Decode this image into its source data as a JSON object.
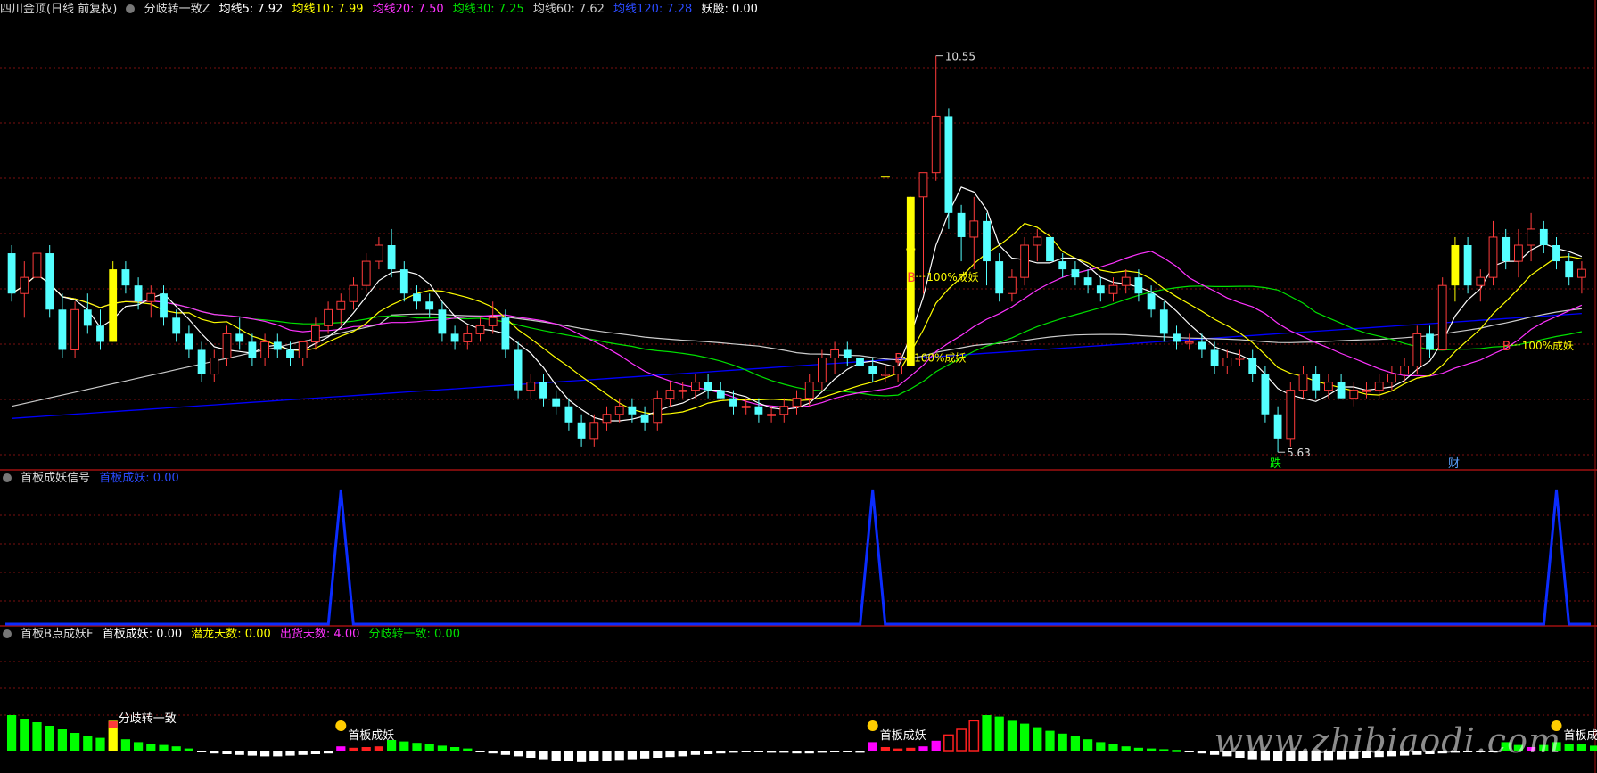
{
  "colors": {
    "up": "#ff3b3b",
    "down": "#54ffff",
    "ma5": "#ffffff",
    "ma10": "#ffff00",
    "ma20": "#ff33ff",
    "ma30": "#00e000",
    "ma60": "#cccccc",
    "ma120": "#0000ff",
    "grid": "#7a1010",
    "signal": "#ff33ff",
    "blue_line": "#0b2cff",
    "green_bar": "#00ff00",
    "white_bar": "#ffffff",
    "magenta_bar": "#ff00ff",
    "red_bar": "#ff2020",
    "yellow": "#ffff00"
  },
  "panel1": {
    "title": "四川金顶(日线 前复权)",
    "indicator": "分歧转一致Z",
    "ma5": "均线5: 7.92",
    "ma10": "均线10: 7.99",
    "ma20": "均线20: 7.50",
    "ma30": "均线30: 7.25",
    "ma60": "均线60: 7.62",
    "ma120": "均线120: 7.28",
    "yaogu": "妖股: 0.00",
    "high_label": "10.55",
    "low_label": "5.63",
    "annotations": [
      "100%成妖",
      "100%成妖",
      "100%成妖"
    ],
    "b_labels": [
      "B",
      "B",
      "B"
    ],
    "die_label": "跌",
    "cai_label": "财"
  },
  "panel2": {
    "title": "首板成妖信号",
    "value_label": "首板成妖: 0.00"
  },
  "panel3": {
    "title": "首板B点成妖F",
    "v1": "首板成妖: 0.00",
    "v2": "潜龙天数: 0.00",
    "v3": "出货天数: 4.00",
    "v4": "分歧转一致: 0.00",
    "labels": [
      "分歧转一致",
      "首板成妖",
      "首板成妖",
      "首板成妖"
    ]
  },
  "watermark": "www.zhibiaodi.com",
  "chart_data": [
    {
      "type": "candlestick",
      "title": "四川金顶(日线 前复权)",
      "high": 10.55,
      "low": 5.63,
      "ylim": [
        5.4,
        11.0
      ],
      "ohlc": [
        [
          8.1,
          8.2,
          7.5,
          7.6
        ],
        [
          7.6,
          8.0,
          7.3,
          7.8
        ],
        [
          7.8,
          8.3,
          7.7,
          8.1
        ],
        [
          8.1,
          8.2,
          7.3,
          7.4
        ],
        [
          7.4,
          7.6,
          6.8,
          6.9
        ],
        [
          6.9,
          7.5,
          6.8,
          7.4
        ],
        [
          7.4,
          7.6,
          7.1,
          7.2
        ],
        [
          7.2,
          7.4,
          6.9,
          7.0
        ],
        [
          7.0,
          8.0,
          7.0,
          7.9
        ],
        [
          7.9,
          8.0,
          7.6,
          7.7
        ],
        [
          7.7,
          7.8,
          7.4,
          7.5
        ],
        [
          7.5,
          7.7,
          7.3,
          7.6
        ],
        [
          7.6,
          7.7,
          7.2,
          7.3
        ],
        [
          7.3,
          7.4,
          7.0,
          7.1
        ],
        [
          7.1,
          7.2,
          6.8,
          6.9
        ],
        [
          6.9,
          7.0,
          6.5,
          6.6
        ],
        [
          6.6,
          6.9,
          6.5,
          6.8
        ],
        [
          6.8,
          7.2,
          6.7,
          7.1
        ],
        [
          7.1,
          7.3,
          6.9,
          7.0
        ],
        [
          7.0,
          7.1,
          6.7,
          6.8
        ],
        [
          6.8,
          7.1,
          6.7,
          7.0
        ],
        [
          7.0,
          7.1,
          6.8,
          6.9
        ],
        [
          6.9,
          7.0,
          6.7,
          6.8
        ],
        [
          6.8,
          7.0,
          6.7,
          7.0
        ],
        [
          7.0,
          7.3,
          6.9,
          7.2
        ],
        [
          7.2,
          7.5,
          7.1,
          7.4
        ],
        [
          7.4,
          7.6,
          7.2,
          7.5
        ],
        [
          7.5,
          7.8,
          7.4,
          7.7
        ],
        [
          7.7,
          8.1,
          7.6,
          8.0
        ],
        [
          8.0,
          8.3,
          7.9,
          8.2
        ],
        [
          8.2,
          8.4,
          7.8,
          7.9
        ],
        [
          7.9,
          8.0,
          7.5,
          7.6
        ],
        [
          7.6,
          7.7,
          7.4,
          7.5
        ],
        [
          7.5,
          7.6,
          7.3,
          7.4
        ],
        [
          7.4,
          7.5,
          7.0,
          7.1
        ],
        [
          7.1,
          7.2,
          6.9,
          7.0
        ],
        [
          7.0,
          7.2,
          6.9,
          7.1
        ],
        [
          7.1,
          7.3,
          7.0,
          7.2
        ],
        [
          7.2,
          7.5,
          7.1,
          7.3
        ],
        [
          7.3,
          7.4,
          6.8,
          6.9
        ],
        [
          6.9,
          7.0,
          6.3,
          6.4
        ],
        [
          6.4,
          6.6,
          6.3,
          6.5
        ],
        [
          6.5,
          6.6,
          6.2,
          6.3
        ],
        [
          6.3,
          6.4,
          6.1,
          6.2
        ],
        [
          6.2,
          6.3,
          5.9,
          6.0
        ],
        [
          6.0,
          6.1,
          5.7,
          5.8
        ],
        [
          5.8,
          6.1,
          5.7,
          6.0
        ],
        [
          6.0,
          6.2,
          5.9,
          6.1
        ],
        [
          6.1,
          6.3,
          6.0,
          6.2
        ],
        [
          6.2,
          6.3,
          6.0,
          6.1
        ],
        [
          6.1,
          6.2,
          5.9,
          6.0
        ],
        [
          6.0,
          6.4,
          5.9,
          6.3
        ],
        [
          6.3,
          6.5,
          6.2,
          6.4
        ],
        [
          6.4,
          6.5,
          6.3,
          6.4
        ],
        [
          6.4,
          6.6,
          6.3,
          6.5
        ],
        [
          6.5,
          6.6,
          6.3,
          6.4
        ],
        [
          6.4,
          6.5,
          6.3,
          6.3
        ],
        [
          6.3,
          6.4,
          6.1,
          6.2
        ],
        [
          6.2,
          6.3,
          6.1,
          6.2
        ],
        [
          6.2,
          6.3,
          6.0,
          6.1
        ],
        [
          6.1,
          6.2,
          6.0,
          6.1
        ],
        [
          6.1,
          6.3,
          6.0,
          6.2
        ],
        [
          6.2,
          6.4,
          6.1,
          6.3
        ],
        [
          6.3,
          6.6,
          6.2,
          6.5
        ],
        [
          6.5,
          6.9,
          6.4,
          6.8
        ],
        [
          6.8,
          7.0,
          6.6,
          6.9
        ],
        [
          6.9,
          7.0,
          6.7,
          6.8
        ],
        [
          6.8,
          6.9,
          6.6,
          6.7
        ],
        [
          6.7,
          6.8,
          6.5,
          6.6
        ],
        [
          6.6,
          6.7,
          6.5,
          6.6
        ],
        [
          6.6,
          6.8,
          6.5,
          6.7
        ],
        [
          6.7,
          8.8,
          6.7,
          8.8
        ],
        [
          8.8,
          9.1,
          7.6,
          9.1
        ],
        [
          9.1,
          10.55,
          9.0,
          9.8
        ],
        [
          9.8,
          9.9,
          8.4,
          8.6
        ],
        [
          8.6,
          8.7,
          8.0,
          8.3
        ],
        [
          8.3,
          8.8,
          7.9,
          8.5
        ],
        [
          8.5,
          8.6,
          7.7,
          8.0
        ],
        [
          8.0,
          8.1,
          7.5,
          7.6
        ],
        [
          7.6,
          7.9,
          7.5,
          7.8
        ],
        [
          7.8,
          8.3,
          7.7,
          8.2
        ],
        [
          8.2,
          8.4,
          8.0,
          8.3
        ],
        [
          8.3,
          8.4,
          7.9,
          8.0
        ],
        [
          8.0,
          8.1,
          7.8,
          7.9
        ],
        [
          7.9,
          8.0,
          7.7,
          7.8
        ],
        [
          7.8,
          7.9,
          7.6,
          7.7
        ],
        [
          7.7,
          7.8,
          7.5,
          7.6
        ],
        [
          7.6,
          7.8,
          7.5,
          7.7
        ],
        [
          7.7,
          7.9,
          7.6,
          7.8
        ],
        [
          7.8,
          7.9,
          7.5,
          7.6
        ],
        [
          7.6,
          7.7,
          7.3,
          7.4
        ],
        [
          7.4,
          7.5,
          7.0,
          7.1
        ],
        [
          7.1,
          7.2,
          6.9,
          7.0
        ],
        [
          7.0,
          7.1,
          6.9,
          7.0
        ],
        [
          7.0,
          7.1,
          6.8,
          6.9
        ],
        [
          6.9,
          7.0,
          6.6,
          6.7
        ],
        [
          6.7,
          6.9,
          6.6,
          6.8
        ],
        [
          6.8,
          6.9,
          6.7,
          6.8
        ],
        [
          6.8,
          6.9,
          6.5,
          6.6
        ],
        [
          6.6,
          6.7,
          6.0,
          6.1
        ],
        [
          6.1,
          6.2,
          5.63,
          5.8
        ],
        [
          5.8,
          6.5,
          5.7,
          6.4
        ],
        [
          6.4,
          6.7,
          6.3,
          6.6
        ],
        [
          6.6,
          6.7,
          6.3,
          6.4
        ],
        [
          6.4,
          6.6,
          6.3,
          6.5
        ],
        [
          6.5,
          6.6,
          6.3,
          6.3
        ],
        [
          6.3,
          6.5,
          6.2,
          6.4
        ],
        [
          6.4,
          6.5,
          6.3,
          6.4
        ],
        [
          6.4,
          6.6,
          6.3,
          6.5
        ],
        [
          6.5,
          6.7,
          6.4,
          6.6
        ],
        [
          6.6,
          6.8,
          6.5,
          6.7
        ],
        [
          6.7,
          7.2,
          6.6,
          7.1
        ],
        [
          7.1,
          7.2,
          6.8,
          6.9
        ],
        [
          6.9,
          7.8,
          6.9,
          7.7
        ],
        [
          7.7,
          8.3,
          7.5,
          8.2
        ],
        [
          8.2,
          8.3,
          7.6,
          7.7
        ],
        [
          7.7,
          7.9,
          7.5,
          7.8
        ],
        [
          7.8,
          8.5,
          7.7,
          8.3
        ],
        [
          8.3,
          8.4,
          7.9,
          8.0
        ],
        [
          8.0,
          8.4,
          7.8,
          8.2
        ],
        [
          8.2,
          8.6,
          8.0,
          8.4
        ],
        [
          8.4,
          8.5,
          8.1,
          8.2
        ],
        [
          8.2,
          8.3,
          7.9,
          8.0
        ],
        [
          8.0,
          8.1,
          7.7,
          7.8
        ],
        [
          7.8,
          8.0,
          7.6,
          7.9
        ]
      ],
      "limit_up_days": [
        8,
        71,
        114
      ]
    },
    {
      "type": "line",
      "title": "首板成妖信号",
      "signal_indices": [
        26,
        68,
        122
      ],
      "values_note_range": [
        0,
        1
      ]
    },
    {
      "type": "bar",
      "title": "首板B点成妖F",
      "values": [
        5,
        4.5,
        4,
        3.5,
        3,
        2.5,
        2,
        1.8,
        4.2,
        1.6,
        1.2,
        1,
        0.8,
        0.6,
        0.3,
        -0.2,
        -0.4,
        -0.5,
        -0.6,
        -0.7,
        -0.8,
        -0.8,
        -0.7,
        -0.6,
        -0.5,
        -0.4,
        0.6,
        0.4,
        0.5,
        0.6,
        1.5,
        1.3,
        1.1,
        0.9,
        0.7,
        0.5,
        0.3,
        -0.2,
        -0.4,
        -0.6,
        -0.8,
        -1.0,
        -1.2,
        -1.4,
        -1.5,
        -1.6,
        -1.5,
        -1.4,
        -1.3,
        -1.2,
        -1.1,
        -1.0,
        -0.9,
        -0.8,
        -0.6,
        -0.5,
        -0.4,
        -0.3,
        -0.2,
        -0.2,
        -0.3,
        -0.3,
        -0.4,
        -0.4,
        -0.3,
        -0.2,
        -0.1,
        -0.3,
        1.2,
        0.5,
        0.3,
        0.4,
        0.6,
        1.4,
        2.2,
        3.0,
        4.2,
        5.0,
        4.8,
        4.2,
        3.8,
        3.3,
        2.8,
        2.4,
        2.0,
        1.6,
        1.2,
        0.9,
        0.6,
        0.4,
        0.3,
        0.2,
        0.1,
        -0.2,
        -0.4,
        -0.6,
        -0.8,
        -1.0,
        -1.2,
        -1.3,
        -1.4,
        -1.5,
        -1.5,
        -1.4,
        -1.3,
        -1.2,
        -1.1,
        -1.0,
        -0.9,
        -0.8,
        -0.7,
        -0.6,
        -0.5,
        -0.4,
        -0.3,
        -0.2,
        -0.1,
        -0.2,
        1.2,
        0.8,
        0.5,
        0.8,
        1.2,
        1.0,
        0.9,
        0.7,
        0.6,
        0.5,
        0.4,
        0.3
      ]
    }
  ]
}
